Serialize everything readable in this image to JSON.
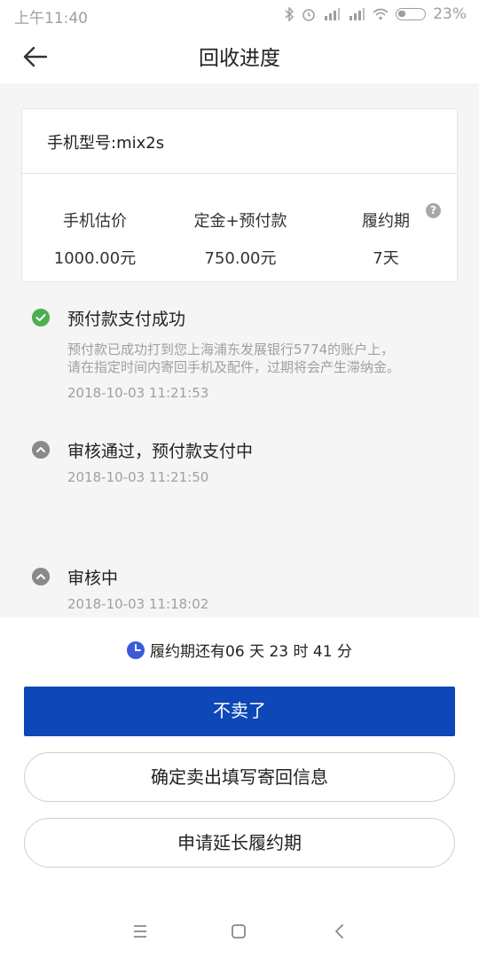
{
  "status_bar": {
    "time": "上午11:40",
    "battery": "23%",
    "icons": [
      "bluetooth-icon",
      "alarm-icon",
      "signal-hd-icon",
      "signal-hd-icon",
      "wifi-icon",
      "battery-icon"
    ]
  },
  "nav": {
    "title": "回收进度",
    "back_icon": "arrow-left-icon"
  },
  "card": {
    "model": "手机型号:mix2s",
    "columns": [
      {
        "label": "手机估价",
        "value": "1000.00元"
      },
      {
        "label": "定金+预付款",
        "value": "750.00元"
      },
      {
        "label": "履约期",
        "value": "7天"
      }
    ],
    "help_glyph": "?"
  },
  "timeline": [
    {
      "status": "success",
      "title": "预付款支付成功",
      "desc_line1": "预付款已成功打到您上海浦东发展银行5774的账户上，",
      "desc_line2": "请在指定时间内寄回手机及配件，过期将会产生滞纳金。",
      "time": "2018-10-03 11:21:53"
    },
    {
      "status": "pending",
      "title": "审核通过，预付款支付中",
      "time": "2018-10-03 11:21:50"
    },
    {
      "status": "pending",
      "title": "审核中",
      "time": "2018-10-03 11:18:02"
    }
  ],
  "countdown": {
    "text": "履约期还有06 天 23 时 41 分"
  },
  "buttons": {
    "cancel": "不卖了",
    "confirm": "确定卖出填写寄回信息",
    "extend": "申请延长履约期"
  },
  "colors": {
    "primary": "#0d47b8",
    "success": "#4caf50",
    "clock": "#3b5bdb"
  }
}
